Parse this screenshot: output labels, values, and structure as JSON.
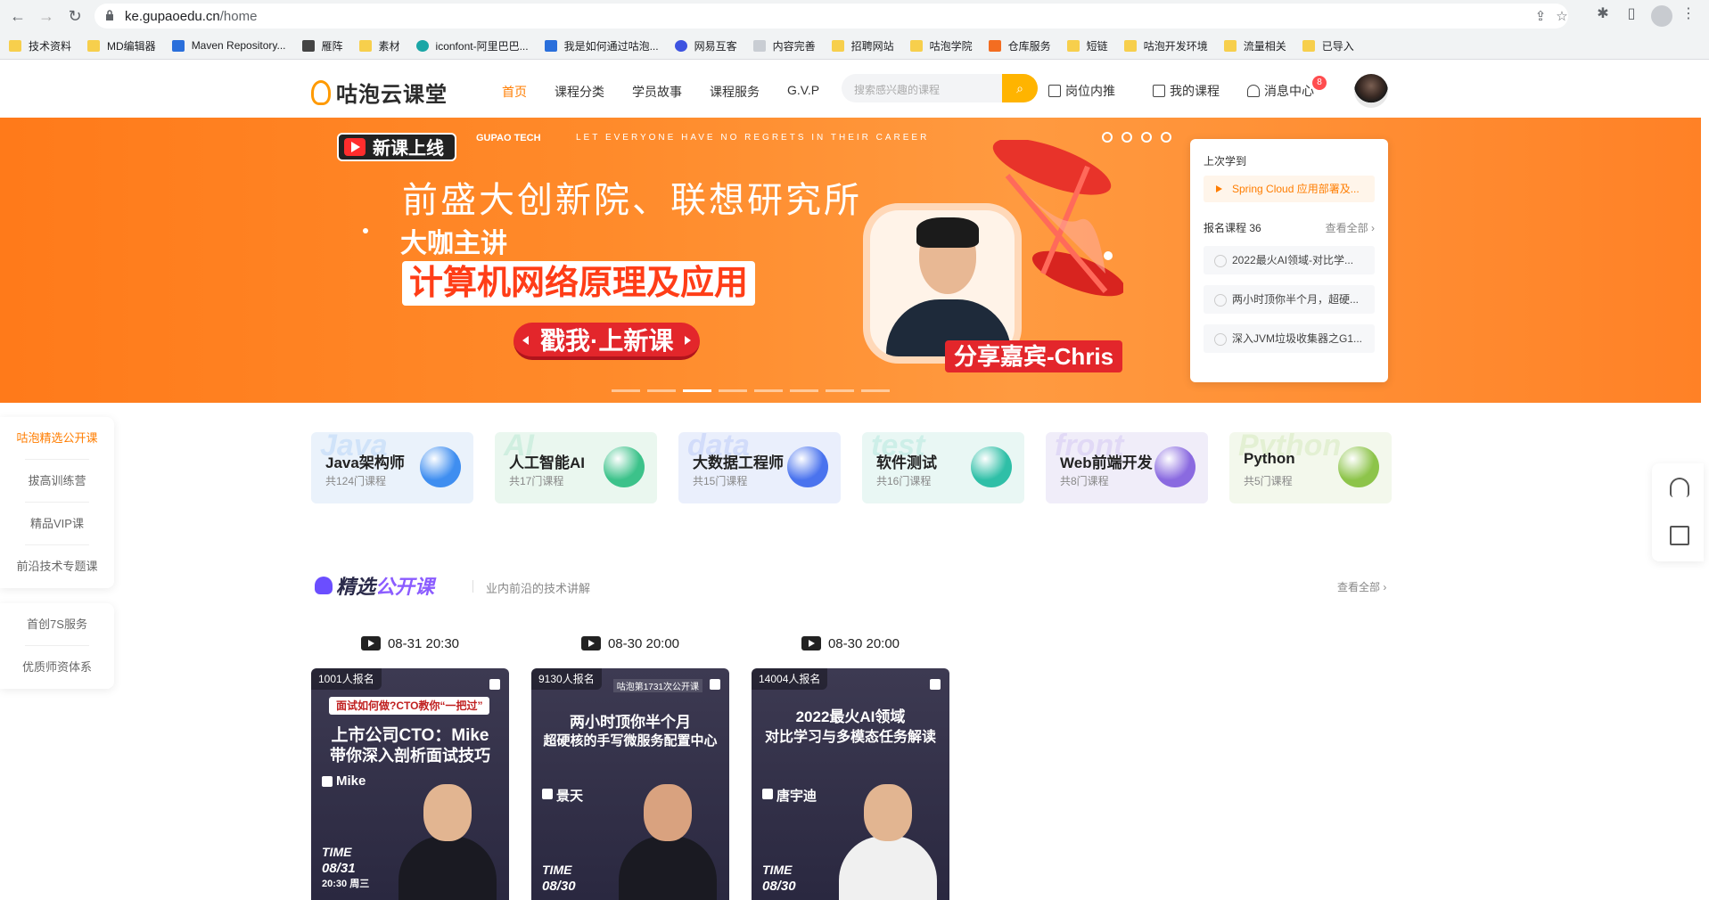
{
  "browser": {
    "url_host": "ke.gupaoedu.cn",
    "url_path": "/home",
    "bookmarks": [
      {
        "label": "技术资料",
        "icon": "folder-icon",
        "color": "folder"
      },
      {
        "label": "MD编辑器",
        "icon": "folder-icon",
        "color": "folder"
      },
      {
        "label": "Maven Repository...",
        "icon": "maven-icon",
        "color": "blue"
      },
      {
        "label": "雁阵",
        "icon": "bird-icon",
        "color": "dark"
      },
      {
        "label": "素材",
        "icon": "folder-icon",
        "color": "folder"
      },
      {
        "label": "iconfont-阿里巴巴...",
        "icon": "iconfont-icon",
        "color": "teal"
      },
      {
        "label": "我是如何通过咕泡...",
        "icon": "link-icon",
        "color": "blue"
      },
      {
        "label": "网易互客",
        "icon": "netease-icon",
        "color": "indigo"
      },
      {
        "label": "内容完善",
        "icon": "page-icon",
        "color": "gray"
      },
      {
        "label": "招聘网站",
        "icon": "folder-icon",
        "color": "folder"
      },
      {
        "label": "咕泡学院",
        "icon": "folder-icon",
        "color": "folder"
      },
      {
        "label": "仓库服务",
        "icon": "code-icon",
        "color": "orange"
      },
      {
        "label": "短链",
        "icon": "folder-icon",
        "color": "folder"
      },
      {
        "label": "咕泡开发环境",
        "icon": "folder-icon",
        "color": "folder"
      },
      {
        "label": "流量相关",
        "icon": "folder-icon",
        "color": "folder"
      },
      {
        "label": "已导入",
        "icon": "folder-icon",
        "color": "folder"
      }
    ]
  },
  "header": {
    "logo_text": "咕泡云课堂",
    "nav": [
      "首页",
      "课程分类",
      "学员故事",
      "课程服务",
      "G.V.P"
    ],
    "search_placeholder": "搜索感兴趣的课程",
    "links": [
      "岗位内推",
      "我的课程",
      "消息中心"
    ],
    "message_count": "8"
  },
  "banner": {
    "new_tag": "新课上线",
    "brand": "GUPAO TECH",
    "slogan": "LET EVERYONE HAVE NO REGRETS IN THEIR CAREER",
    "subtitle": "前盛大创新院、联想研究所",
    "host_line": "大咖主讲",
    "course_title": "计算机网络原理及应用",
    "cta": "戳我·上新课",
    "guest": "分享嘉宾-Chris",
    "active_slide": 3,
    "slide_count": 8
  },
  "learning": {
    "last_label": "上次学到",
    "last_course": "Spring Cloud 应用部署及...",
    "enrolled_label": "报名课程 36",
    "view_all": "查看全部 ›",
    "items": [
      "2022最火AI领域-对比学...",
      "两小时顶你半个月，超硬...",
      "深入JVM垃圾收集器之G1..."
    ]
  },
  "left_menu": {
    "group1": [
      "咕泡精选公开课",
      "拔高训练营",
      "精品VIP课",
      "前沿技术专题课"
    ],
    "group2": [
      "首创7S服务",
      "优质师资体系"
    ]
  },
  "categories": [
    {
      "name": "Java架构师",
      "count": "共124门课程",
      "ghost": "Java",
      "bg": "#eaf2fb",
      "ball": "#3f8ef0"
    },
    {
      "name": "人工智能AI",
      "count": "共17门课程",
      "ghost": "AI",
      "bg": "#eaf7ef",
      "ball": "#3cc28a"
    },
    {
      "name": "大数据工程师",
      "count": "共15门课程",
      "ghost": "data",
      "bg": "#eaeffc",
      "ball": "#4a73ee"
    },
    {
      "name": "软件测试",
      "count": "共16门课程",
      "ghost": "test",
      "bg": "#e9f7f4",
      "ball": "#2fbfa7"
    },
    {
      "name": "Web前端开发",
      "count": "共8门课程",
      "ghost": "front",
      "bg": "#f0edf9",
      "ball": "#8a6ae0"
    },
    {
      "name": "Python",
      "count": "共5门课程",
      "ghost": "Python",
      "bg": "#f3f8ec",
      "ball": "#8dc44a"
    }
  ],
  "section": {
    "title_a": "精选",
    "title_b": "公开课",
    "desc": "业内前沿的技术讲解",
    "more": "查看全部 ›"
  },
  "courses": [
    {
      "time": "08-31 20:30",
      "enroll": "1001人报名",
      "pill": "面试如何做?CTO教你“一把过”",
      "title1": "上市公司CTO：Mike",
      "title2": "带你深入剖析面试技巧",
      "lecturer": "Mike",
      "time_label": "TIME",
      "date": "08/31",
      "clock": "20:30 周三"
    },
    {
      "time": "08-30 20:00",
      "enroll": "9130人报名",
      "topline": "咕泡第1731次公开课",
      "title1": "两小时顶你半个月",
      "title2": "超硬核的手写微服务配置中心",
      "lecturer": "景天",
      "time_label": "TIME",
      "date": "08/30"
    },
    {
      "time": "08-30 20:00",
      "enroll": "14004人报名",
      "title1": "2022最火AI领域",
      "title2": "对比学习与多模态任务解读",
      "lecturer": "唐宇迪",
      "time_label": "TIME",
      "date": "08/30"
    }
  ]
}
